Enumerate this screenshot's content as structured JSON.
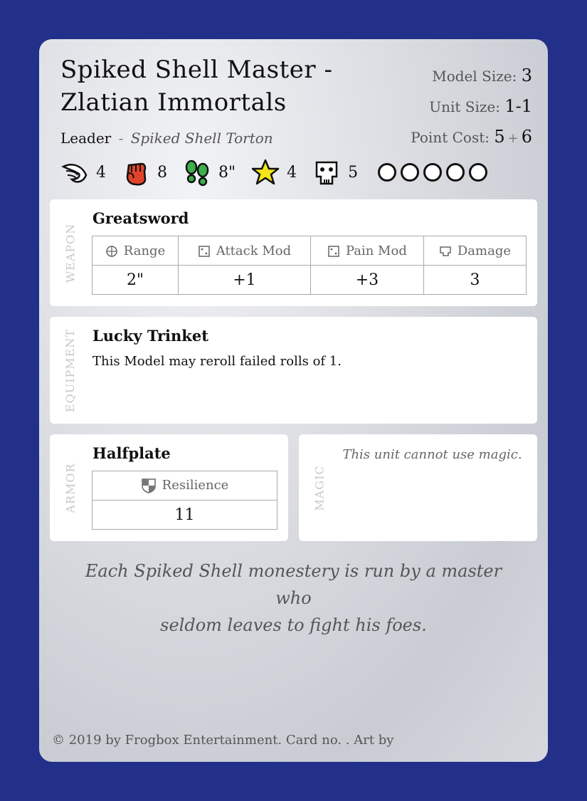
{
  "card": {
    "title_line1": "Spiked Shell Master -",
    "title_line2": "Zlatian Immortals",
    "role": "Leader",
    "separator": "-",
    "subtype": "Spiked Shell Torton",
    "model_size_label": "Model Size:",
    "model_size": "3",
    "unit_size_label": "Unit Size:",
    "unit_size": "1-1",
    "point_cost_label": "Point Cost:",
    "point_cost_base": "5",
    "point_cost_plus": "+",
    "point_cost_extra": "6"
  },
  "stats": [
    {
      "icon": "wing-icon",
      "value": "4"
    },
    {
      "icon": "fist-icon",
      "value": "8"
    },
    {
      "icon": "footprints-icon",
      "value": "8\""
    },
    {
      "icon": "star-icon",
      "value": "4"
    },
    {
      "icon": "skull-icon",
      "value": "5"
    }
  ],
  "wounds": 5,
  "weapon": {
    "section_label": "WEAPON",
    "name": "Greatsword",
    "headers": [
      "Range",
      "Attack Mod",
      "Pain Mod",
      "Damage"
    ],
    "values": [
      "2\"",
      "+1",
      "+3",
      "3"
    ]
  },
  "equipment": {
    "section_label": "EQUIPMENT",
    "name": "Lucky Trinket",
    "text": "This Model may reroll failed rolls of 1."
  },
  "armor": {
    "section_label": "ARMOR",
    "name": "Halfplate",
    "header": "Resilience",
    "value": "11"
  },
  "magic": {
    "section_label": "MAGIC",
    "text": "This unit cannot use magic."
  },
  "flavor_line1": "Each Spiked Shell monestery is run by a master who",
  "flavor_line2": "seldom leaves to fight his foes.",
  "footer": "© 2019 by Frogbox Entertainment. Card no. . Art by",
  "colors": {
    "background": "#22308a",
    "fist": "#e0442a",
    "footprints": "#3cb04a",
    "star": "#f3e51c"
  }
}
